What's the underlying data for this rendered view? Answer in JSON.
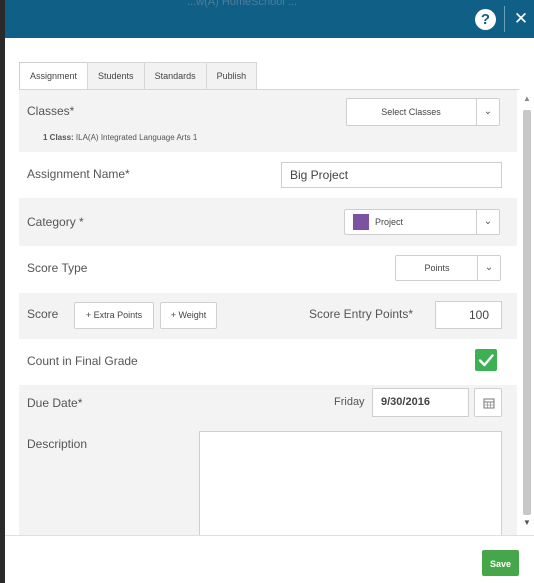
{
  "titlebar": {
    "ghost_text": "...w(A) HomeSchool ...",
    "help_icon": "?",
    "close_icon": "✕"
  },
  "tabs": [
    {
      "label": "Assignment",
      "active": true
    },
    {
      "label": "Students",
      "active": false
    },
    {
      "label": "Standards",
      "active": false
    },
    {
      "label": "Publish",
      "active": false
    }
  ],
  "form": {
    "classes": {
      "label": "Classes*",
      "button": "Select Classes",
      "summary_bold": "1 Class:",
      "summary": "ILA(A) Integrated Language Arts 1"
    },
    "assignment_name": {
      "label": "Assignment Name*",
      "value": "Big Project"
    },
    "category": {
      "label": "Category *",
      "value": "Project",
      "color": "#7c52a1"
    },
    "score_type": {
      "label": "Score Type",
      "value": "Points"
    },
    "score": {
      "label": "Score",
      "extra_points": "+ Extra Points",
      "weight": "+ Weight",
      "entry_label": "Score Entry Points*",
      "entry_value": "100"
    },
    "count_final": {
      "label": "Count in Final Grade",
      "checked": true
    },
    "due_date": {
      "label": "Due Date*",
      "weekday": "Friday",
      "value": "9/30/2016"
    },
    "description": {
      "label": "Description",
      "value": ""
    }
  },
  "footer": {
    "save": "Save"
  },
  "colors": {
    "titlebar": "#0f5f86",
    "save": "#46a74a",
    "checkbox": "#3db054"
  }
}
